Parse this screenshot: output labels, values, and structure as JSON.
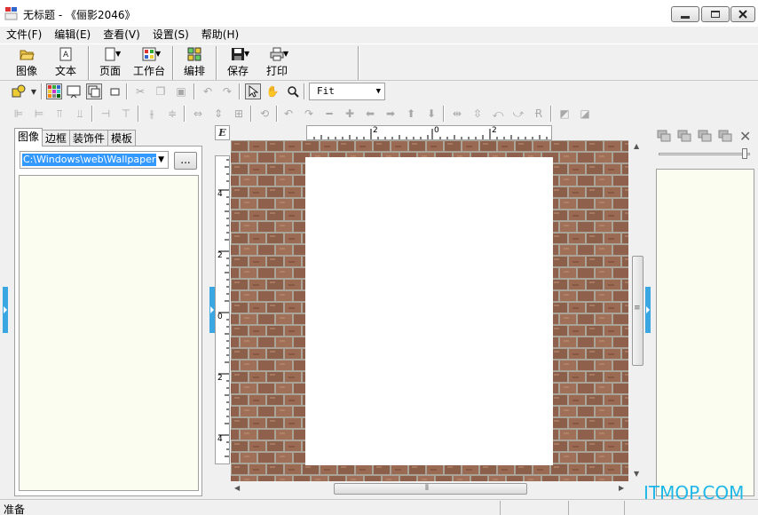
{
  "window": {
    "title": "无标题 - 《俪影2046》"
  },
  "menu": [
    "文件(F)",
    "编辑(E)",
    "查看(V)",
    "设置(S)",
    "帮助(H)"
  ],
  "toolbar_main": {
    "image": "图像",
    "text": "文本",
    "page": "页面",
    "workbench": "工作台",
    "layout": "编排",
    "save": "保存",
    "print": "打印"
  },
  "zoom": {
    "value": "Fit"
  },
  "left_panel": {
    "tabs": [
      "图像",
      "边框",
      "装饰件",
      "模板"
    ],
    "active_tab": "图像",
    "path": "C:\\Windows\\web\\Wallpaper",
    "browse_label": "..."
  },
  "ruler": {
    "corner": "E",
    "h_labels": [
      "2",
      "0",
      "2"
    ],
    "v_labels": [
      "4",
      "2",
      "0",
      "2",
      "4"
    ]
  },
  "status": {
    "text": "准备"
  },
  "watermark": "ITMOP.COM",
  "colors": {
    "selection": "#3399ff",
    "splitter": "#3aa7e2",
    "panel_bg": "#fbfdf0",
    "brick": "#8a5a45",
    "mortar": "#a8a39a",
    "watermark": "#1fb7e8"
  }
}
